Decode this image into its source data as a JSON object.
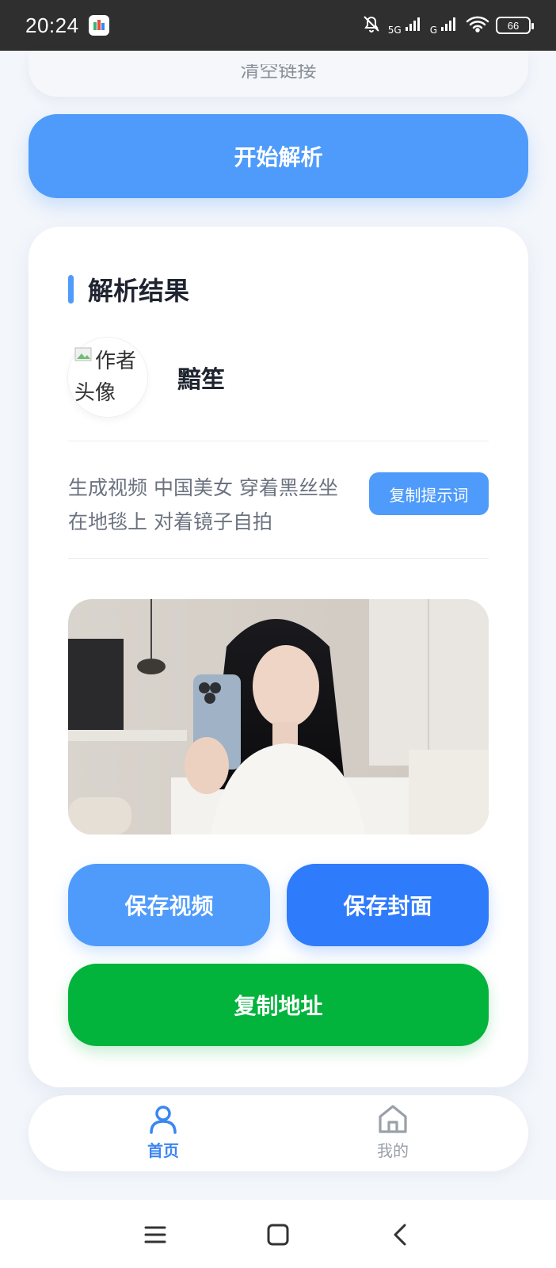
{
  "status_bar": {
    "time": "20:24",
    "signal1_label": "5G",
    "signal2_label": "G",
    "battery": "66",
    "icons": [
      "app-notification-icon",
      "mute-bell-icon",
      "signal-icon",
      "wifi-icon",
      "battery-icon"
    ]
  },
  "top_card": {
    "clear_label": "清空链接"
  },
  "start_button": "开始解析",
  "result": {
    "title": "解析结果",
    "avatar_alt": "作者头像",
    "author_name": "黯笙",
    "prompt": "生成视频 中国美女 穿着黑丝坐在地毯上 对着镜子自拍",
    "copy_prompt_label": "复制提示词",
    "save_video_label": "保存视频",
    "save_cover_label": "保存封面",
    "copy_url_label": "复制地址"
  },
  "tabs": [
    {
      "label": "首页",
      "icon": "user-icon",
      "active": true
    },
    {
      "label": "我的",
      "icon": "home-icon",
      "active": false
    }
  ],
  "nav_icons": [
    "menu-icon",
    "home-square-icon",
    "back-icon"
  ],
  "colors": {
    "primary": "#4e9bfb",
    "primary_dark": "#2e7bfb",
    "green": "#02b33c",
    "tab_active": "#3b86f0"
  }
}
